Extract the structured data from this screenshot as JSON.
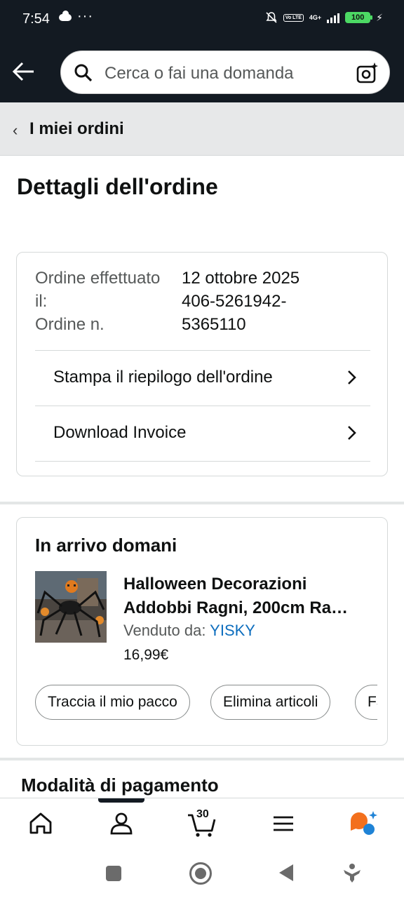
{
  "status_bar": {
    "time": "7:54",
    "network": "4G+",
    "volte": "Vo LTE",
    "battery": "100"
  },
  "search": {
    "placeholder": "Cerca o fai una domanda"
  },
  "breadcrumb": {
    "label": "I miei ordini"
  },
  "page": {
    "title": "Dettagli dell'ordine"
  },
  "order_info": {
    "date_label": "Ordine effettuato il:",
    "number_label": "Ordine n.",
    "date_value": "12 ottobre 2025",
    "number_value": "406-5261942-5365110",
    "actions": [
      {
        "label": "Stampa il riepilogo dell'ordine"
      },
      {
        "label": "Download Invoice"
      }
    ]
  },
  "shipment": {
    "title": "In arrivo domani",
    "product_name": "Halloween Decorazioni Addobbi Ragni, 200cm Ra…",
    "seller_label": "Venduto da:",
    "seller_name": "YISKY",
    "price": "16,99€",
    "buttons": [
      {
        "label": "Traccia il mio pacco"
      },
      {
        "label": "Elimina articoli"
      },
      {
        "label": "Fa"
      }
    ]
  },
  "payment": {
    "title": "Modalità di pagamento"
  },
  "bottom_nav": {
    "cart_count": "30"
  },
  "icons": [
    "back-arrow-icon",
    "search-icon",
    "camera-icon",
    "chevron-left-icon",
    "chevron-right-icon",
    "home-icon",
    "account-icon",
    "cart-icon",
    "menu-icon",
    "rufus-icon"
  ]
}
